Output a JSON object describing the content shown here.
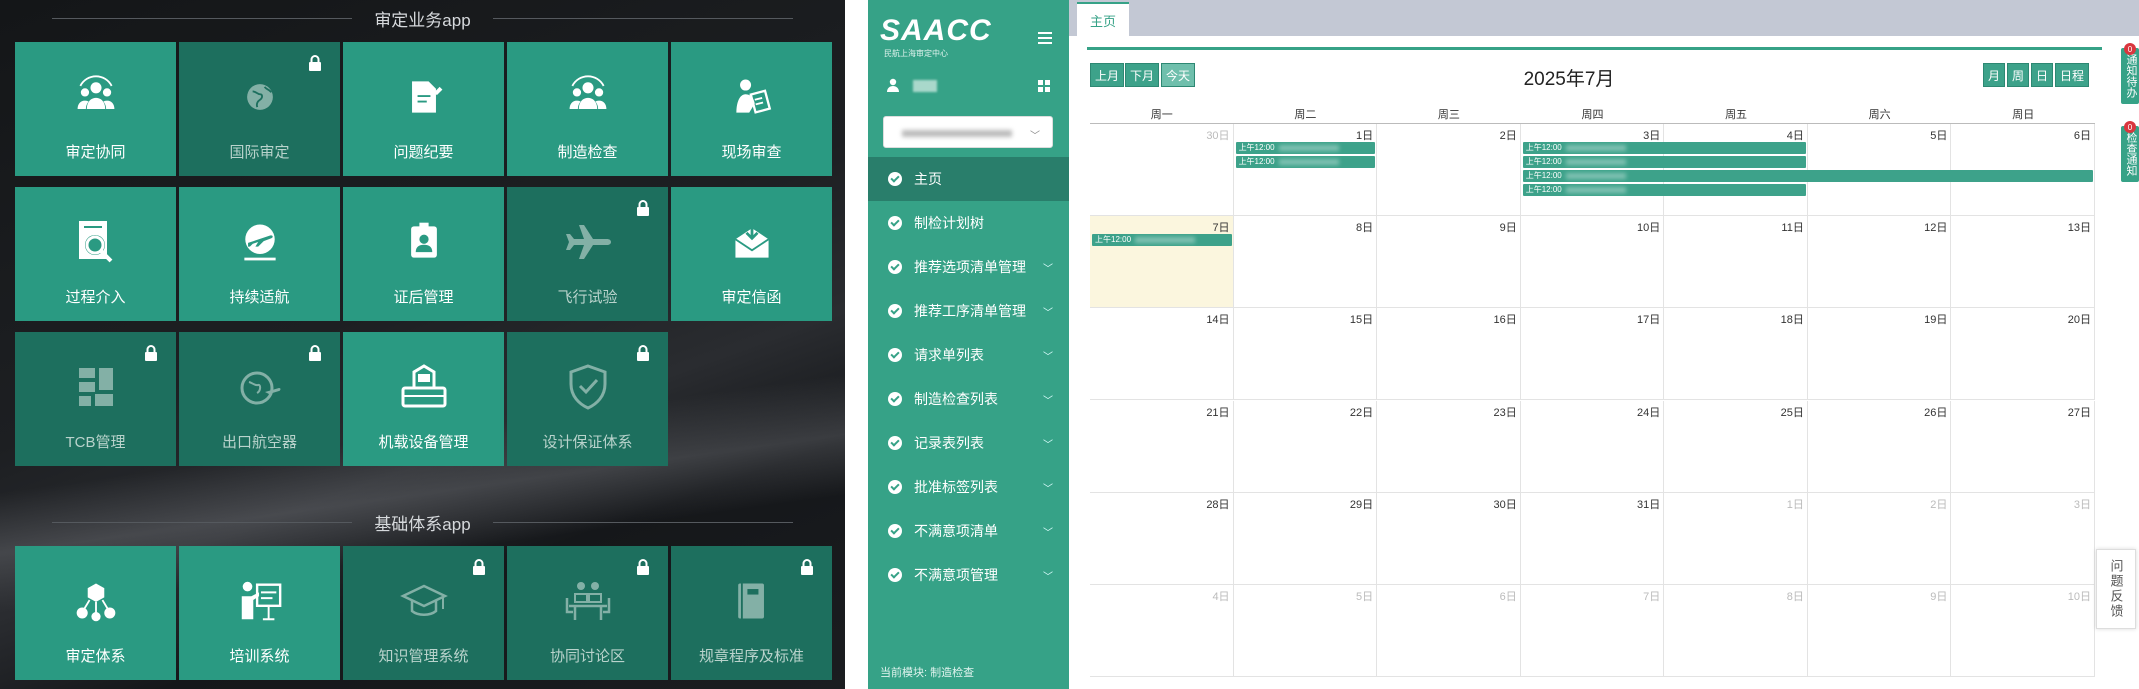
{
  "left_panel": {
    "section1_title": "审定业务app",
    "section2_title": "基础体系app",
    "tiles_section1": [
      {
        "label": "审定协同",
        "icon": "people-group-icon",
        "locked": false
      },
      {
        "label": "国际审定",
        "icon": "globe-icon",
        "locked": true
      },
      {
        "label": "问题纪要",
        "icon": "document-edit-icon",
        "locked": false
      },
      {
        "label": "制造检查",
        "icon": "people-group-icon",
        "locked": false
      },
      {
        "label": "现场审查",
        "icon": "person-inspect-icon",
        "locked": false
      },
      {
        "label": "过程介入",
        "icon": "magnify-document-icon",
        "locked": false
      },
      {
        "label": "持续适航",
        "icon": "airplane-circle-icon",
        "locked": false
      },
      {
        "label": "证后管理",
        "icon": "id-card-icon",
        "locked": false
      },
      {
        "label": "飞行试验",
        "icon": "airplane-icon",
        "locked": true
      },
      {
        "label": "审定信函",
        "icon": "mail-download-icon",
        "locked": false
      },
      {
        "label": "TCB管理",
        "icon": "puzzle-icon",
        "locked": true
      },
      {
        "label": "出口航空器",
        "icon": "globe-plane-icon",
        "locked": true
      },
      {
        "label": "机载设备管理",
        "icon": "device-tray-icon",
        "locked": false
      },
      {
        "label": "设计保证体系",
        "icon": "shield-check-icon",
        "locked": true
      }
    ],
    "tiles_section2": [
      {
        "label": "审定体系",
        "icon": "network-icon",
        "locked": false
      },
      {
        "label": "培训系统",
        "icon": "presentation-icon",
        "locked": false
      },
      {
        "label": "知识管理系统",
        "icon": "graduation-cap-icon",
        "locked": true
      },
      {
        "label": "协同讨论区",
        "icon": "meeting-icon",
        "locked": true
      },
      {
        "label": "规章程序及标准",
        "icon": "book-icon",
        "locked": true
      }
    ]
  },
  "sidebar": {
    "logo": "SAACC",
    "logo_sub": "民航上海审定中心",
    "current_module": "当前模块: 制造检查",
    "nav": [
      {
        "label": "主页",
        "active": true,
        "expand": false
      },
      {
        "label": "制检计划树",
        "active": false,
        "expand": false
      },
      {
        "label": "推荐选项清单管理",
        "active": false,
        "expand": true
      },
      {
        "label": "推荐工序清单管理",
        "active": false,
        "expand": true
      },
      {
        "label": "请求单列表",
        "active": false,
        "expand": true
      },
      {
        "label": "制造检查列表",
        "active": false,
        "expand": true
      },
      {
        "label": "记录表列表",
        "active": false,
        "expand": true
      },
      {
        "label": "批准标签列表",
        "active": false,
        "expand": true
      },
      {
        "label": "不满意项清单",
        "active": false,
        "expand": true
      },
      {
        "label": "不满意项管理",
        "active": false,
        "expand": true
      }
    ]
  },
  "main": {
    "tab": "主页",
    "nav_buttons": {
      "prev": "上月",
      "next": "下月",
      "today": "今天"
    },
    "view_buttons": [
      "月",
      "周",
      "日",
      "日程"
    ],
    "calendar_title": "2025年7月",
    "weekdays": [
      "周一",
      "周二",
      "周三",
      "周四",
      "周五",
      "周六",
      "周日"
    ],
    "weeks": [
      [
        {
          "d": "30日",
          "o": true
        },
        {
          "d": "1日"
        },
        {
          "d": "2日"
        },
        {
          "d": "3日"
        },
        {
          "d": "4日"
        },
        {
          "d": "5日"
        },
        {
          "d": "6日"
        }
      ],
      [
        {
          "d": "7日",
          "today": true
        },
        {
          "d": "8日"
        },
        {
          "d": "9日"
        },
        {
          "d": "10日"
        },
        {
          "d": "11日"
        },
        {
          "d": "12日"
        },
        {
          "d": "13日"
        }
      ],
      [
        {
          "d": "14日"
        },
        {
          "d": "15日"
        },
        {
          "d": "16日"
        },
        {
          "d": "17日"
        },
        {
          "d": "18日"
        },
        {
          "d": "19日"
        },
        {
          "d": "20日"
        }
      ],
      [
        {
          "d": "21日"
        },
        {
          "d": "22日"
        },
        {
          "d": "23日"
        },
        {
          "d": "24日"
        },
        {
          "d": "25日"
        },
        {
          "d": "26日"
        },
        {
          "d": "27日"
        }
      ],
      [
        {
          "d": "28日"
        },
        {
          "d": "29日"
        },
        {
          "d": "30日"
        },
        {
          "d": "31日"
        },
        {
          "d": "1日",
          "o": true
        },
        {
          "d": "2日",
          "o": true
        },
        {
          "d": "3日",
          "o": true
        }
      ],
      [
        {
          "d": "4日",
          "o": true
        },
        {
          "d": "5日",
          "o": true
        },
        {
          "d": "6日",
          "o": true
        },
        {
          "d": "7日",
          "o": true
        },
        {
          "d": "8日",
          "o": true
        },
        {
          "d": "9日",
          "o": true
        },
        {
          "d": "10日",
          "o": true
        }
      ]
    ],
    "events": [
      {
        "week": 0,
        "col": 1,
        "span": 1,
        "row": 0,
        "label": "上午12:00"
      },
      {
        "week": 0,
        "col": 1,
        "span": 1,
        "row": 1,
        "label": "上午12:00"
      },
      {
        "week": 0,
        "col": 3,
        "span": 2,
        "row": 0,
        "label": "上午12:00"
      },
      {
        "week": 0,
        "col": 3,
        "span": 2,
        "row": 1,
        "label": "上午12:00"
      },
      {
        "week": 0,
        "col": 3,
        "span": 4,
        "row": 2,
        "label": "上午12:00"
      },
      {
        "week": 0,
        "col": 3,
        "span": 2,
        "row": 3,
        "label": "上午12:00"
      },
      {
        "week": 1,
        "col": 0,
        "span": 1,
        "row": 0,
        "label": "上午12:00"
      }
    ],
    "notif1": {
      "label": "通知待办",
      "count": "0"
    },
    "notif2": {
      "label": "检查通知",
      "count": "0"
    },
    "feedback": "问题反馈",
    "accent": "#36a287"
  }
}
